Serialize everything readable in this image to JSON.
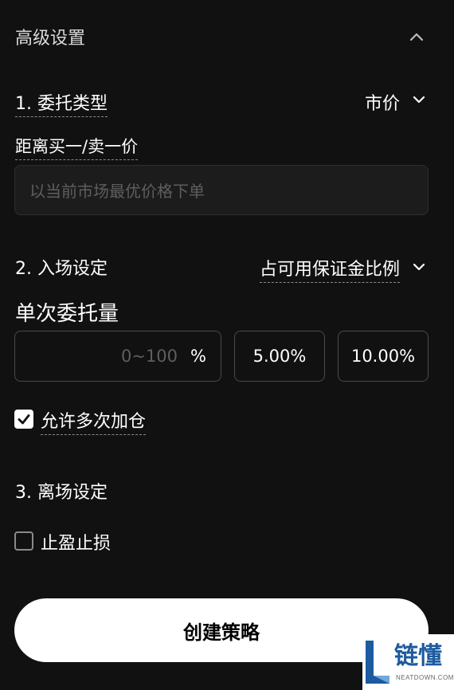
{
  "header": {
    "title": "高级设置",
    "collapse_icon": "chevron-up-icon"
  },
  "section1": {
    "title": "1. 委托类型",
    "order_type": "市价",
    "distance_label": "距离买一/卖一价",
    "price_placeholder": "以当前市场最优价格下单"
  },
  "section2": {
    "title": "2. 入场设定",
    "mode": "占可用保证金比例",
    "qty_label": "单次委托量",
    "qty_placeholder": "0~100",
    "qty_unit": "%",
    "presets": [
      "5.00%",
      "10.00%"
    ],
    "allow_add": {
      "label": "允许多次加仓",
      "checked": true
    }
  },
  "section3": {
    "title": "3. 离场设定",
    "tp_sl": {
      "label": "止盈止损",
      "checked": false
    }
  },
  "create_button": "创建策略",
  "watermark": {
    "text": "链懂",
    "sub": "NEATDOWN.COM"
  },
  "colors": {
    "background": "#111111",
    "primary_button": "#ffffff",
    "watermark_blue": "#1e5aa0"
  }
}
